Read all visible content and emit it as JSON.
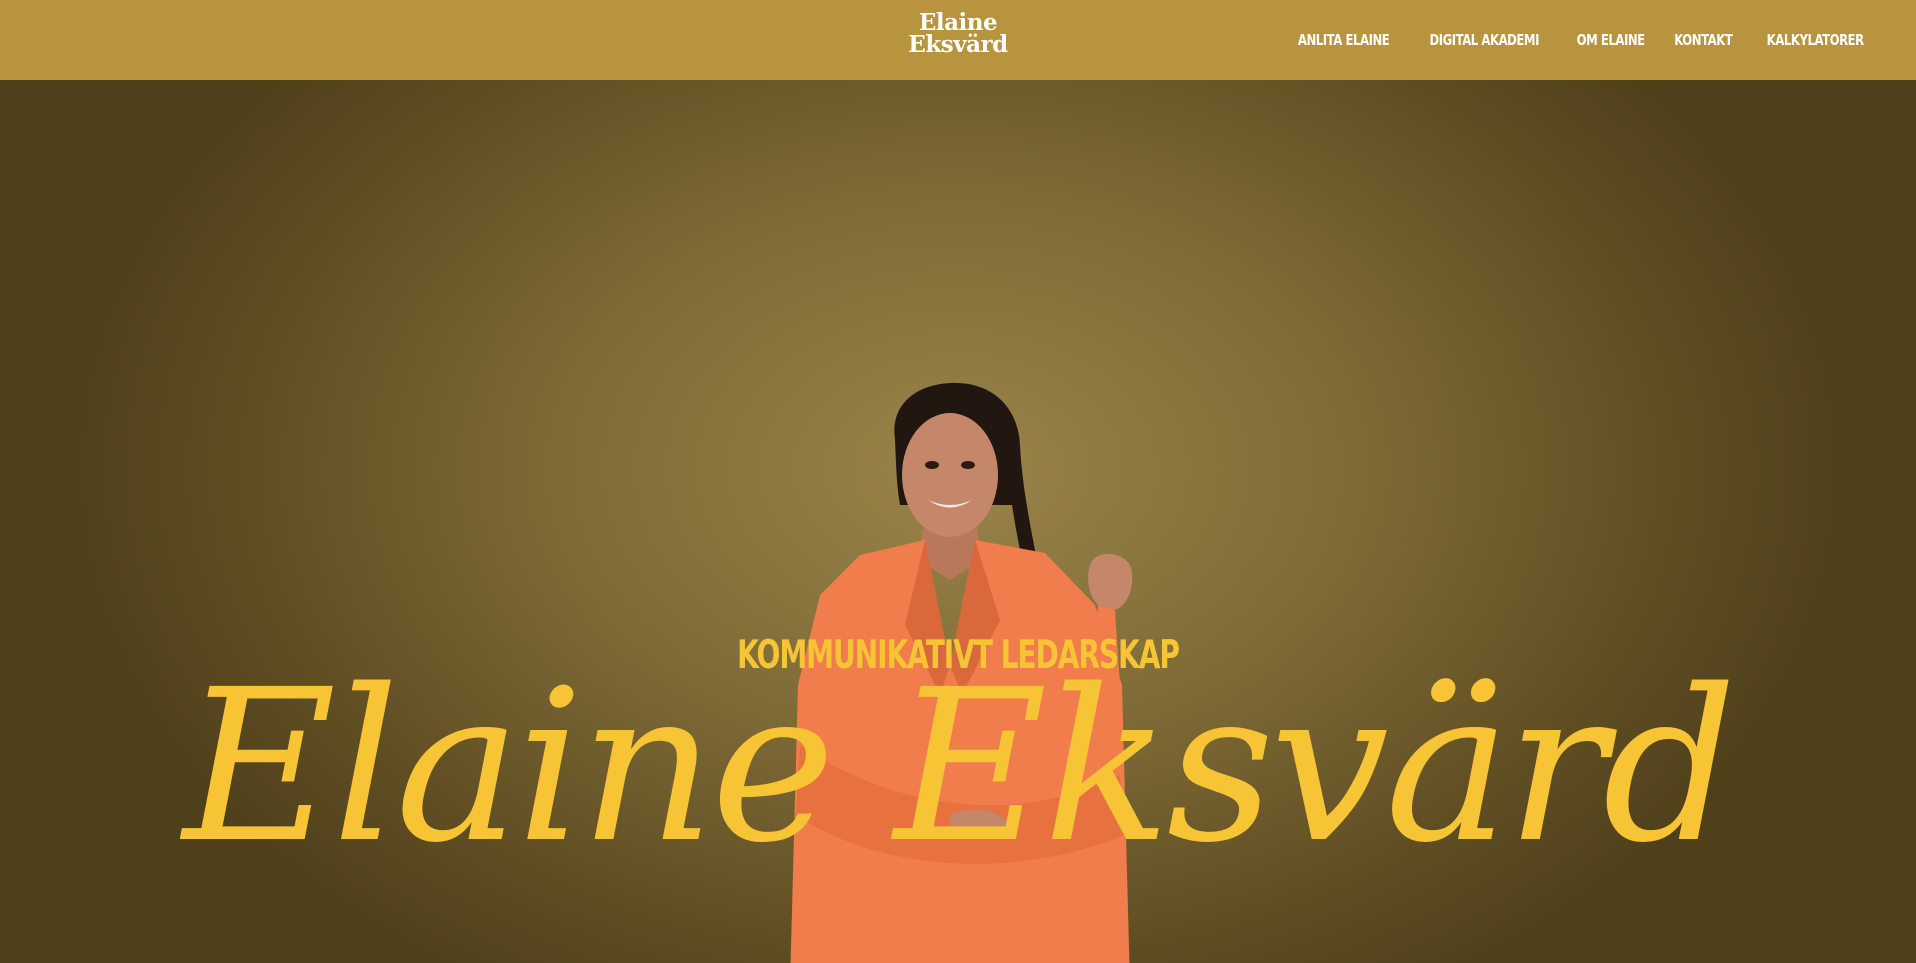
{
  "header": {
    "logo": {
      "line1": "Elaine",
      "line2": "Eksvärd"
    },
    "nav": [
      {
        "label": "ANLITA ELAINE"
      },
      {
        "label": "DIGITAL AKADEMI"
      },
      {
        "label": "OM ELAINE"
      },
      {
        "label": "KONTAKT"
      },
      {
        "label": "KALKYLATORER"
      }
    ]
  },
  "hero": {
    "kicker": "KOMMUNIKATIVT LEDARSKAP",
    "name": "Elaine Eksvärd"
  },
  "colors": {
    "header_bg": "#b8943f",
    "hero_bg": "#7d6a36",
    "accent_yellow": "#f6c435",
    "blazer_orange": "#f07d4b"
  }
}
